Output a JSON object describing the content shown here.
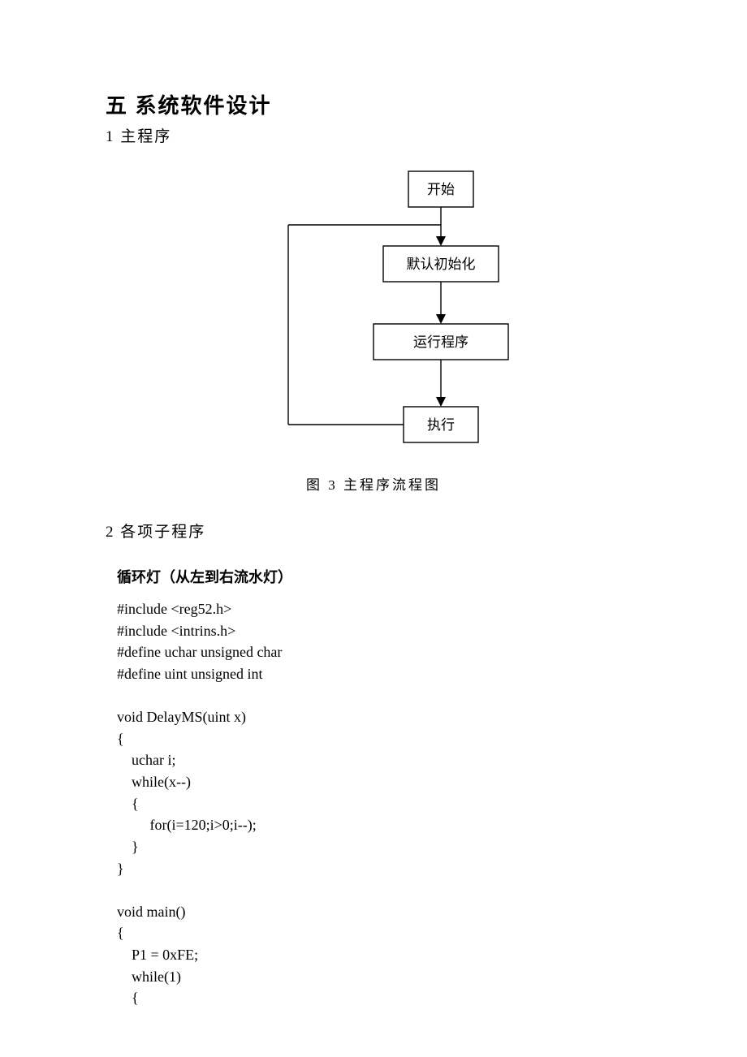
{
  "heading_main": "五  系统软件设计",
  "heading_sub1": "1 主程序",
  "flow": {
    "box1": "开始",
    "box2": "默认初始化",
    "box3": "运行程序",
    "box4": "执行"
  },
  "caption": "图 3 主程序流程图",
  "heading_sub2": "2 各项子程序",
  "subtitle_bold": "循环灯（从左到右流水灯）",
  "code": "#include <reg52.h>\n#include <intrins.h>\n#define uchar unsigned char\n#define uint unsigned int\n\nvoid DelayMS(uint x)\n{\n    uchar i;\n    while(x--)\n    {\n         for(i=120;i>0;i--);\n    }\n}\n\nvoid main()\n{\n    P1 = 0xFE;\n    while(1)\n    {"
}
